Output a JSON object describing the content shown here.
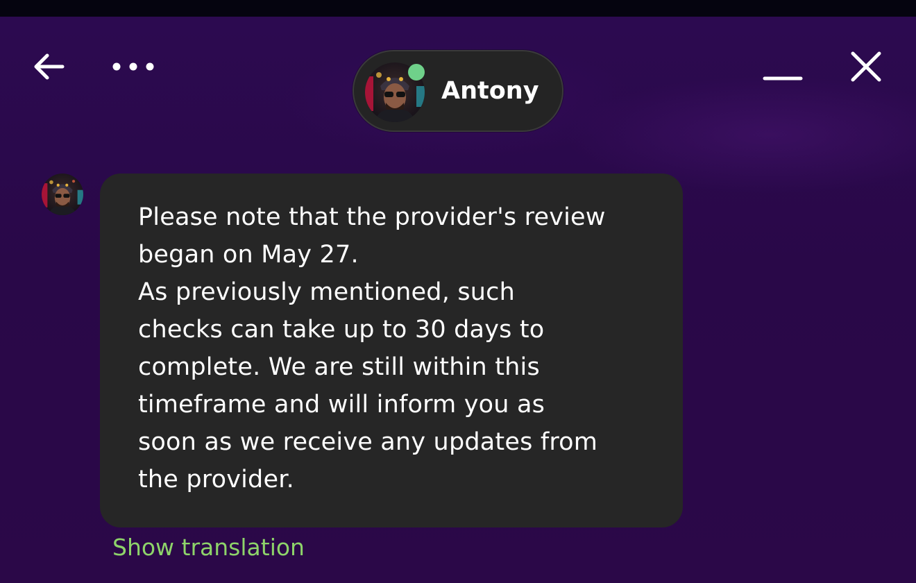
{
  "header": {
    "back_icon": "arrow-left-icon",
    "more_icon": "more-horizontal-icon",
    "minimize_icon": "minimize-icon",
    "close_icon": "close-icon"
  },
  "contact": {
    "name": "Antony",
    "status": "online",
    "status_color": "#6fd18a",
    "avatar_icon": "avatar-photo"
  },
  "message": {
    "text": "Please note that the provider's review\nbegan on May 27.\nAs previously mentioned, such\nchecks can take up to 30 days to\ncomplete. We are still within this\ntimeframe and will inform you as\nsoon as we receive any updates from\nthe provider.",
    "show_translation_label": "Show translation"
  },
  "colors": {
    "background": "#2a0a4a",
    "bubble": "#262626",
    "accent_link": "#8ed46a",
    "online": "#6fd18a"
  }
}
